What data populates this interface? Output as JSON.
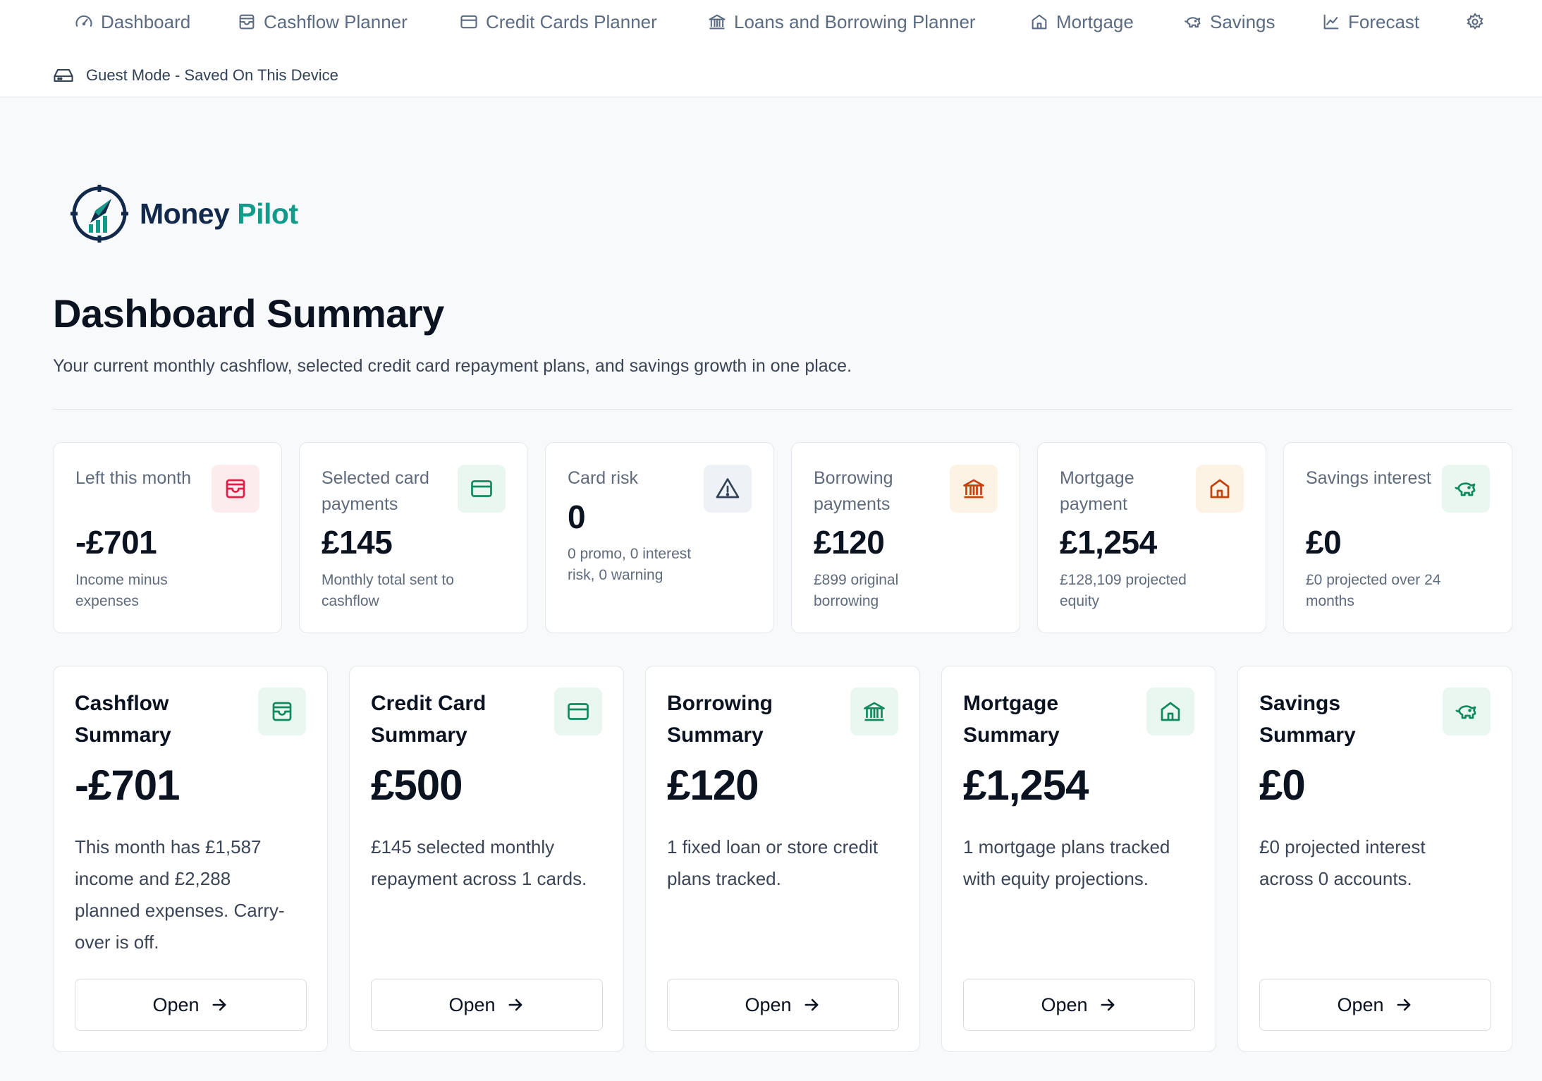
{
  "nav": {
    "items": [
      {
        "label": "Dashboard",
        "icon": "gauge-icon"
      },
      {
        "label": "Cashflow Planner",
        "icon": "wallet-icon"
      },
      {
        "label": "Credit Cards Planner",
        "icon": "credit-card-icon"
      },
      {
        "label": "Loans and Borrowing Planner",
        "icon": "bank-icon"
      },
      {
        "label": "Mortgage",
        "icon": "house-icon"
      },
      {
        "label": "Savings",
        "icon": "piggy-bank-icon"
      },
      {
        "label": "Forecast",
        "icon": "line-chart-icon"
      }
    ],
    "settings_icon": "gear-icon"
  },
  "guest_mode": {
    "label": "Guest Mode - Saved On This Device",
    "icon": "hard-drive-icon"
  },
  "brand": {
    "name_part1": "Money",
    "name_part2": "Pilot",
    "logo_icon": "compass-chart-logo",
    "colors": {
      "navy": "#13294b",
      "teal": "#129a8a"
    }
  },
  "header": {
    "title": "Dashboard Summary",
    "subtitle": "Your current monthly cashflow, selected credit card repayment plans, and savings growth in one place."
  },
  "stats": [
    {
      "label": "Left this month",
      "value": "-£701",
      "note": "Income minus expenses",
      "icon": "wallet-icon",
      "icon_color": "#e11d48",
      "icon_bg": "#fdecee"
    },
    {
      "label": "Selected card payments",
      "value": "£145",
      "note": "Monthly total sent to cashflow",
      "icon": "credit-card-icon",
      "icon_color": "#0f8a5f",
      "icon_bg": "#e9f7f0"
    },
    {
      "label": "Card risk",
      "value": "0",
      "note": "0 promo, 0 interest risk, 0 warning",
      "icon": "warning-triangle-icon",
      "icon_color": "#334155",
      "icon_bg": "#eef1f5"
    },
    {
      "label": "Borrowing payments",
      "value": "£120",
      "note": "£899 original borrowing",
      "icon": "bank-icon",
      "icon_color": "#c2410c",
      "icon_bg": "#fdf3e4"
    },
    {
      "label": "Mortgage payment",
      "value": "£1,254",
      "note": "£128,109 projected equity",
      "icon": "house-icon",
      "icon_color": "#c2410c",
      "icon_bg": "#fdf3e4"
    },
    {
      "label": "Savings interest",
      "value": "£0",
      "note": "£0 projected over 24 months",
      "icon": "piggy-bank-icon",
      "icon_color": "#0f8a5f",
      "icon_bg": "#e9f7f0"
    }
  ],
  "cards": [
    {
      "title": "Cashflow Summary",
      "value": "-£701",
      "desc": "This month has £1,587 income and £2,288 planned expenses. Carry-over is off.",
      "icon": "wallet-icon",
      "button": "Open"
    },
    {
      "title": "Credit Card Summary",
      "value": "£500",
      "desc": "£145 selected monthly repayment across 1 cards.",
      "icon": "credit-card-icon",
      "button": "Open"
    },
    {
      "title": "Borrowing Summary",
      "value": "£120",
      "desc": "1 fixed loan or store credit plans tracked.",
      "icon": "bank-icon",
      "button": "Open"
    },
    {
      "title": "Mortgage Summary",
      "value": "£1,254",
      "desc": "1 mortgage plans tracked with equity projections.",
      "icon": "house-icon",
      "button": "Open"
    },
    {
      "title": "Savings Summary",
      "value": "£0",
      "desc": "£0 projected interest across 0 accounts.",
      "icon": "piggy-bank-icon",
      "button": "Open"
    }
  ],
  "colors": {
    "card_icon": "#0f8a5f",
    "nav_text": "#5b6b82"
  }
}
